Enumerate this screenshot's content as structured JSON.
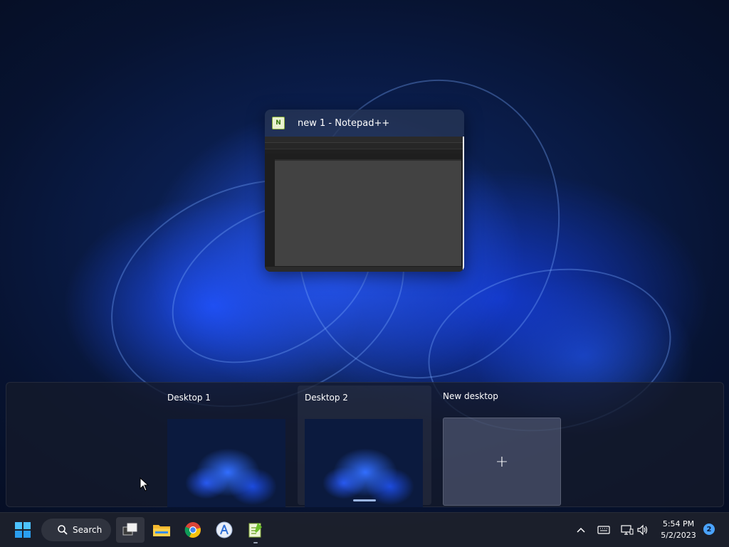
{
  "window_preview": {
    "title": "new 1 - Notepad++",
    "icon": "notepadpp-icon"
  },
  "desktops": [
    {
      "label": "Desktop 1"
    },
    {
      "label": "Desktop 2"
    },
    {
      "label": "New desktop",
      "icon": "plus-icon",
      "glyph": "+"
    }
  ],
  "taskbar": {
    "search_label": "Search",
    "apps": [
      "start-icon",
      "task-view-icon",
      "file-explorer-icon",
      "chrome-icon",
      "app-installer-icon",
      "notepadpp-icon"
    ],
    "tray": {
      "time": "5:54 PM",
      "date": "5/2/2023",
      "notification_count": "2"
    }
  }
}
